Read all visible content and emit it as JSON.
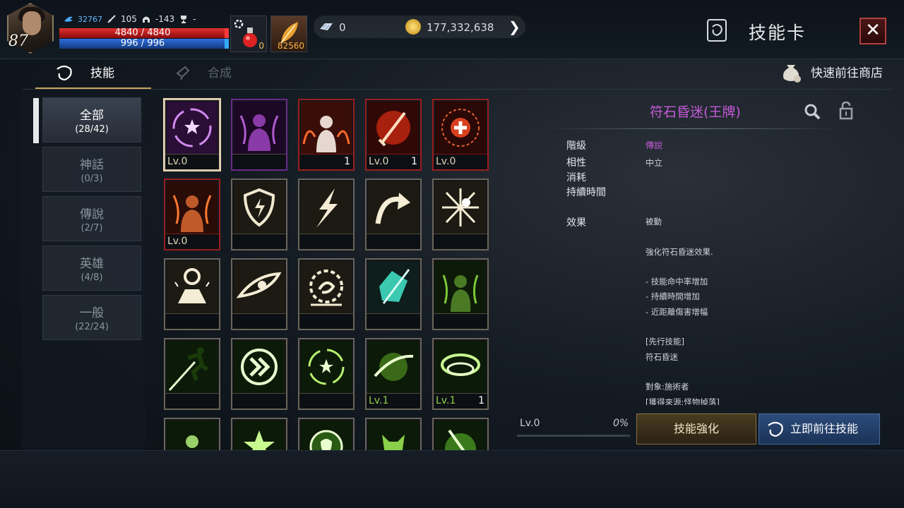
{
  "player": {
    "level": "87",
    "power": "32767",
    "attack": "105",
    "defense": "-143",
    "trophy": "-",
    "hp": "4840 / 4840",
    "mp": "996 / 996"
  },
  "quick_slots": [
    {
      "name": "potion",
      "count": "0"
    },
    {
      "name": "feather",
      "count": "82560"
    }
  ],
  "currency": {
    "crystal": "0",
    "gold": "177,332,638"
  },
  "window": {
    "title": "技能卡",
    "close_icon": "close-icon"
  },
  "tabs": [
    {
      "label": "技能"
    },
    {
      "label": "合成"
    }
  ],
  "shop_link": "快速前往商店",
  "categories": [
    {
      "label": "全部",
      "count": "(28/42)"
    },
    {
      "label": "神話",
      "count": "(0/3)"
    },
    {
      "label": "傳說",
      "count": "(2/7)"
    },
    {
      "label": "英雄",
      "count": "(4/8)"
    },
    {
      "label": "一般",
      "count": "(22/24)"
    }
  ],
  "cards": [
    {
      "lv": "Lv.0",
      "count": ""
    },
    {
      "lv": "",
      "count": ""
    },
    {
      "lv": "",
      "count": "1"
    },
    {
      "lv": "Lv.0",
      "count": "1"
    },
    {
      "lv": "Lv.0",
      "count": ""
    },
    {
      "lv": "Lv.0",
      "count": ""
    },
    {
      "lv": "",
      "count": ""
    },
    {
      "lv": "",
      "count": ""
    },
    {
      "lv": "",
      "count": ""
    },
    {
      "lv": "",
      "count": ""
    },
    {
      "lv": "",
      "count": ""
    },
    {
      "lv": "",
      "count": ""
    },
    {
      "lv": "",
      "count": ""
    },
    {
      "lv": "",
      "count": ""
    },
    {
      "lv": "",
      "count": ""
    },
    {
      "lv": "",
      "count": ""
    },
    {
      "lv": "",
      "count": ""
    },
    {
      "lv": "",
      "count": ""
    },
    {
      "lv": "Lv.1",
      "count": ""
    },
    {
      "lv": "Lv.1",
      "count": "1"
    },
    {
      "lv": "",
      "count": ""
    },
    {
      "lv": "",
      "count": ""
    },
    {
      "lv": "",
      "count": ""
    },
    {
      "lv": "",
      "count": ""
    },
    {
      "lv": "",
      "count": ""
    }
  ],
  "detail": {
    "name": "符石昏迷(王牌)",
    "grade_label": "階級",
    "grade": "傳說",
    "affinity_label": "相性",
    "affinity": "中立",
    "cost_label": "消耗",
    "duration_label": "持續時間",
    "effect_label": "效果",
    "effect_text": "被動\n\n強化符石昏迷效果.\n\n- 技能命中率增加\n- 持續時間增加\n- 近距離傷害增幅\n\n[先行技能]\n符石昏迷\n\n對象:施術者\n[獲得來源:怪物掉落]",
    "level": "Lv.0",
    "progress": "0%",
    "upgrade_button": "技能強化",
    "goto_button": "立即前往技能"
  }
}
